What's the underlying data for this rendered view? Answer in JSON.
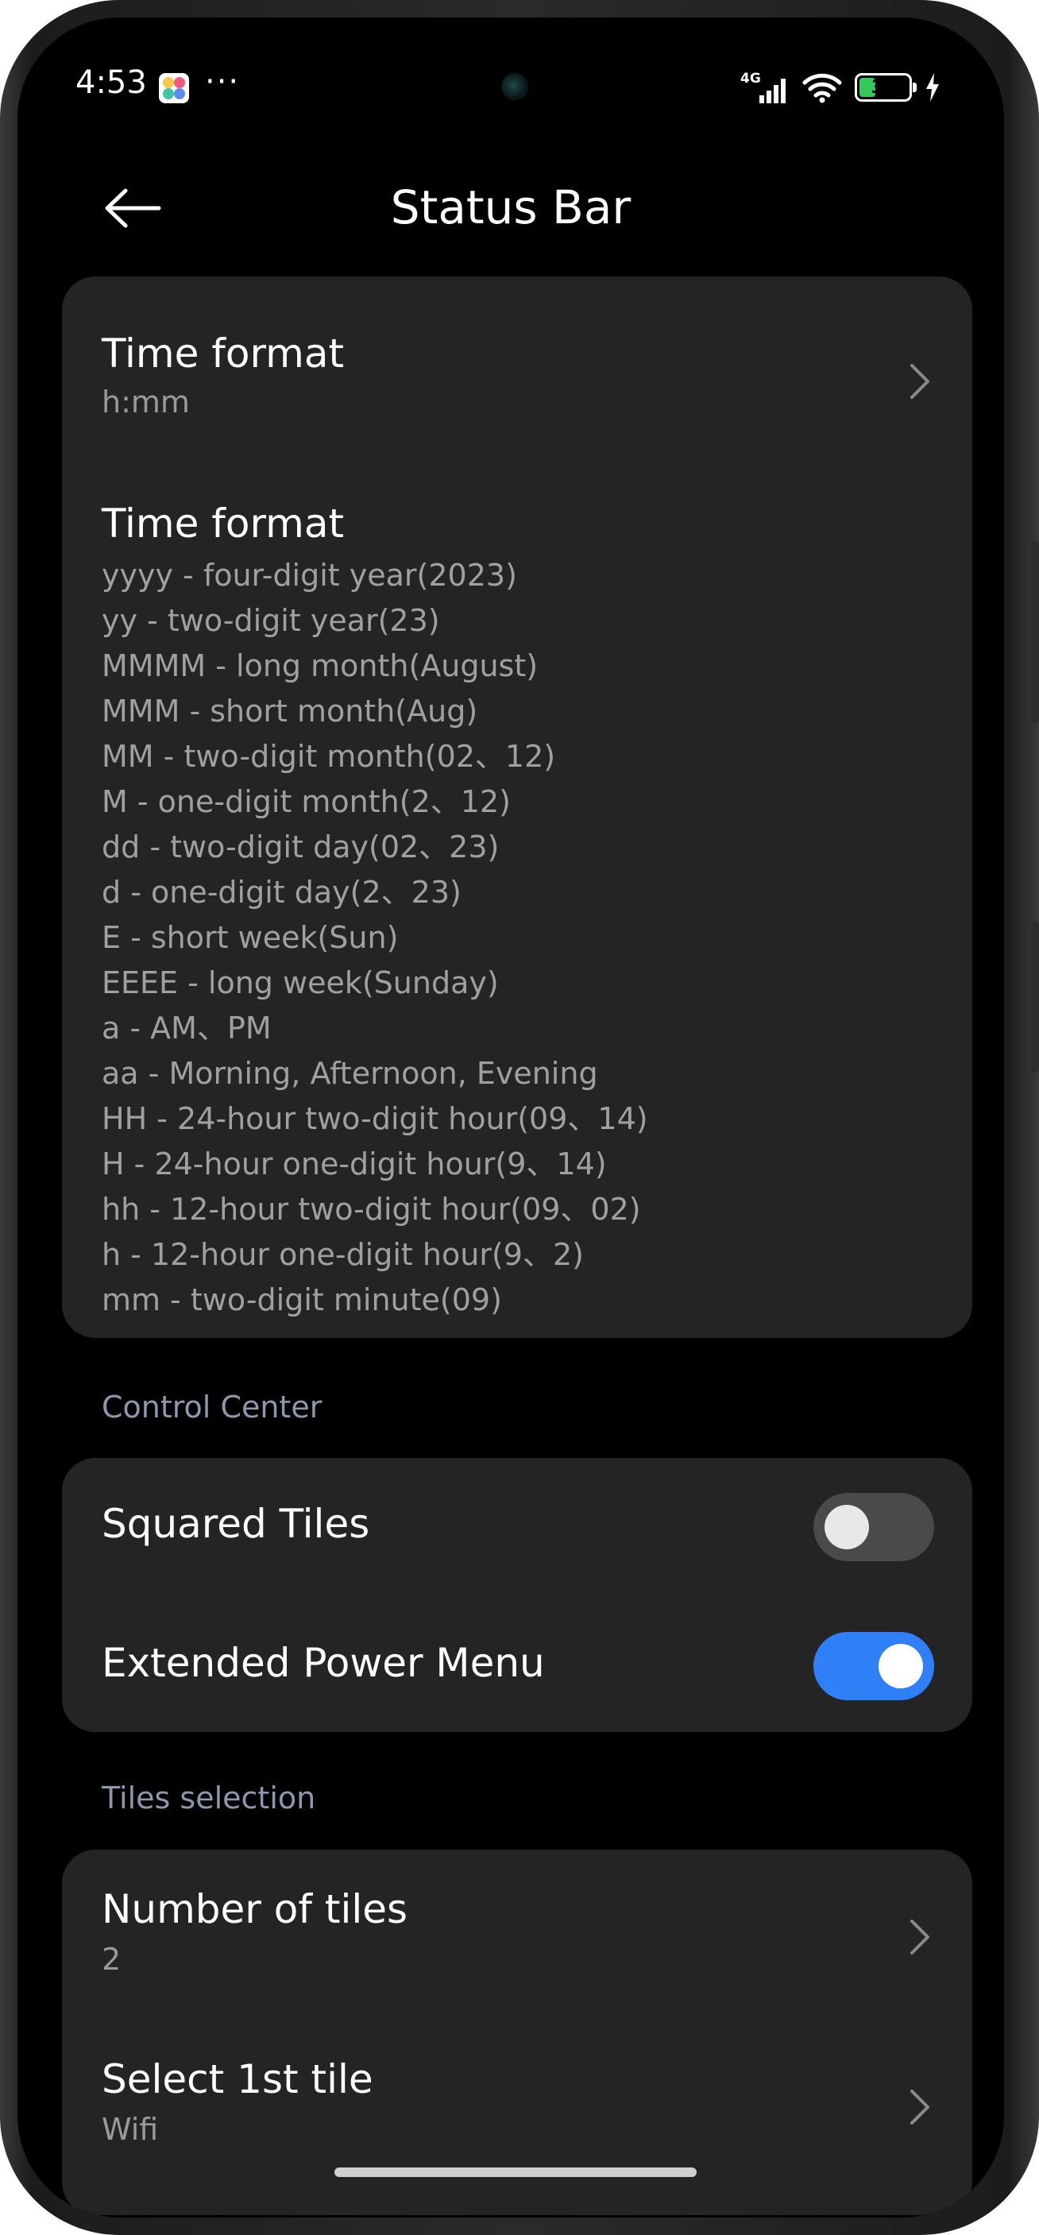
{
  "status_bar": {
    "time": "4:53",
    "more": "···",
    "network": "4G",
    "battery": "33",
    "battery_level": 0.33,
    "colors": {
      "battery_fill": "#35c759"
    },
    "icons": [
      "app-icon",
      "signal-icon",
      "wifi-icon",
      "battery-icon",
      "charging-icon"
    ]
  },
  "header": {
    "title": "Status Bar",
    "back_icon": "arrow-left-icon"
  },
  "time_format_card": {
    "setting_title": "Time format",
    "setting_value": "h:mm",
    "help_title": "Time format",
    "help_lines": [
      "yyyy - four-digit year(2023)",
      "yy - two-digit year(23)",
      "MMMM - long month(August)",
      "MMM - short month(Aug)",
      "MM - two-digit month(02、12)",
      "M - one-digit month(2、12)",
      "dd - two-digit day(02、23)",
      "d - one-digit day(2、23)",
      "E - short week(Sun)",
      "EEEE - long week(Sunday)",
      "a - AM、PM",
      "aa - Morning, Afternoon, Evening",
      "HH - 24-hour two-digit hour(09、14)",
      "H - 24-hour one-digit hour(9、14)",
      "hh - 12-hour two-digit hour(09、02)",
      "h - 12-hour one-digit hour(9、2)",
      "mm - two-digit minute(09)"
    ]
  },
  "control_center": {
    "section_label": "Control Center",
    "squared_tiles": {
      "label": "Squared Tiles",
      "enabled": false
    },
    "extended_power_menu": {
      "label": "Extended Power Menu",
      "enabled": true
    },
    "colors": {
      "toggle_on": "#2f7ff7",
      "toggle_off": "#4a4a4a"
    }
  },
  "tiles_selection": {
    "section_label": "Tiles selection",
    "number_of_tiles": {
      "title": "Number of tiles",
      "value": "2"
    },
    "select_1st_tile": {
      "title": "Select 1st tile",
      "value": "Wifi"
    }
  }
}
